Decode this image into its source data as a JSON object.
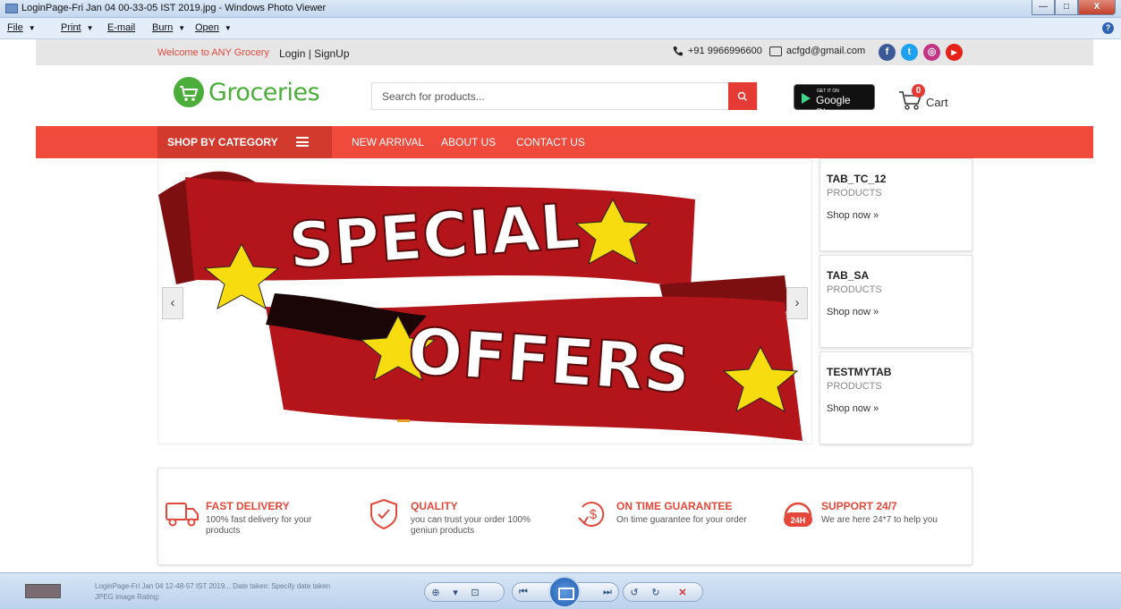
{
  "window": {
    "title": "LoginPage-Fri Jan 04 00-33-05 IST 2019.jpg - Windows Photo Viewer",
    "menu": [
      "File",
      "Print",
      "E-mail",
      "Burn",
      "Open"
    ],
    "help": "?"
  },
  "topbar": {
    "welcome": "Welcome to ANY Grocery",
    "login": "Login | SignUp",
    "phone": "+91 9966996600",
    "email": "acfgd@gmail.com",
    "social": [
      {
        "name": "facebook",
        "glyph": "f",
        "color": "#3b5998"
      },
      {
        "name": "twitter",
        "glyph": "t",
        "color": "#1da1f2"
      },
      {
        "name": "instagram",
        "glyph": "◎",
        "color": "#c13584"
      },
      {
        "name": "youtube",
        "glyph": "▶",
        "color": "#e62117"
      }
    ]
  },
  "header": {
    "logo_text": "Groceries",
    "search_placeholder": "Search for products...",
    "gplay_small": "GET IT ON",
    "gplay_big": "Google Play",
    "cart_count": "0",
    "cart_label": "Cart"
  },
  "nav": {
    "category": "SHOP BY CATEGORY",
    "links": [
      "NEW ARRIVAL",
      "ABOUT US",
      "CONTACT US"
    ]
  },
  "banner": {
    "line1": "SPECIAL",
    "line2": "OFFERS",
    "prev": "‹",
    "next": "›"
  },
  "tabs": [
    {
      "title": "TAB_TC_12",
      "sub": "PRODUCTS",
      "link": "Shop now »"
    },
    {
      "title": "TAB_SA",
      "sub": "PRODUCTS",
      "link": "Shop now »"
    },
    {
      "title": "TESTMYTAB",
      "sub": "PRODUCTS",
      "link": "Shop now »"
    }
  ],
  "features": [
    {
      "title": "FAST DELIVERY",
      "desc": "100% fast delivery for your products"
    },
    {
      "title": "QUALITY",
      "desc": "you can trust your order 100% geniun products"
    },
    {
      "title": "ON TIME GUARANTEE",
      "desc": "On time guarantee for your order"
    },
    {
      "title": "SUPPORT 24/7",
      "desc": "We are here 24*7 to help you"
    }
  ],
  "viewer_bottom": {
    "file_line1": "LoginPage-Fri Jan 04 12-48-57 IST 2019...  Date taken: Specify date taken",
    "file_line2": "JPEG image                                   Rating:"
  },
  "colors": {
    "accent_red": "#ef4a3b",
    "brand_green": "#4cae3a"
  }
}
